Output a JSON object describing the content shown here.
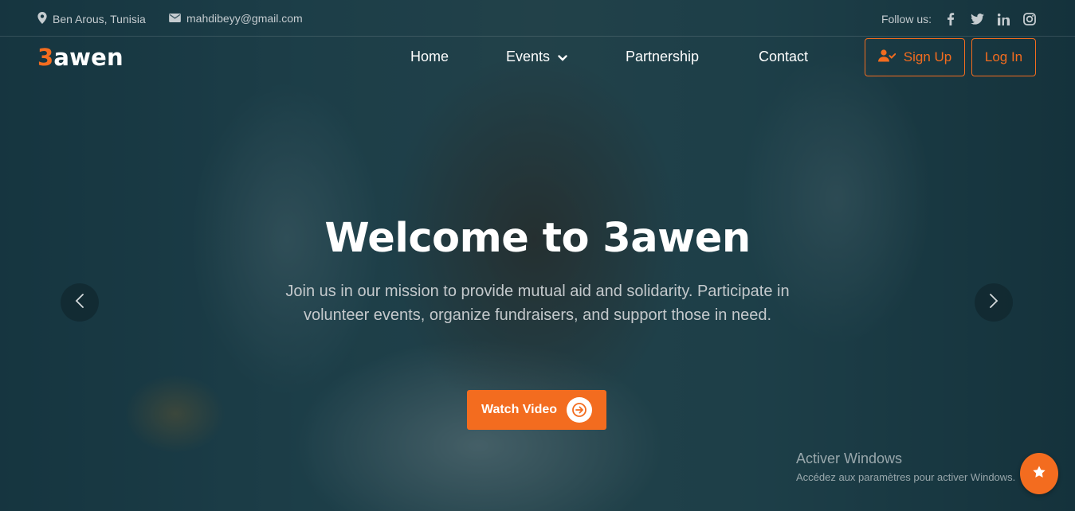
{
  "topbar": {
    "location": "Ben Arous, Tunisia",
    "email": "mahdibeyy@gmail.com",
    "follow_label": "Follow us:",
    "social_icons": [
      "facebook-icon",
      "twitter-icon",
      "linkedin-icon",
      "instagram-icon"
    ]
  },
  "brand": {
    "logo_accent": "3",
    "logo_rest": "awen"
  },
  "nav": {
    "items": [
      {
        "label": "Home"
      },
      {
        "label": "Events",
        "has_dropdown": true
      },
      {
        "label": "Partnership"
      },
      {
        "label": "Contact"
      }
    ],
    "signup_label": "Sign Up",
    "login_label": "Log In"
  },
  "hero": {
    "title": "Welcome to 3awen",
    "description": "Join us in our mission to provide mutual aid and solidarity. Participate in volunteer events, organize fundraisers, and support those in need.",
    "watch_label": "Watch Video"
  },
  "carousel": {
    "prev_icon": "chevron-left-icon",
    "next_icon": "chevron-right-icon"
  },
  "os_watermark": {
    "line1": "Activer Windows",
    "line2": "Accédez aux paramètres pour activer Windows."
  },
  "colors": {
    "accent": "#f36c1f",
    "overlay": "#13313a",
    "text_light": "#ffffff"
  }
}
